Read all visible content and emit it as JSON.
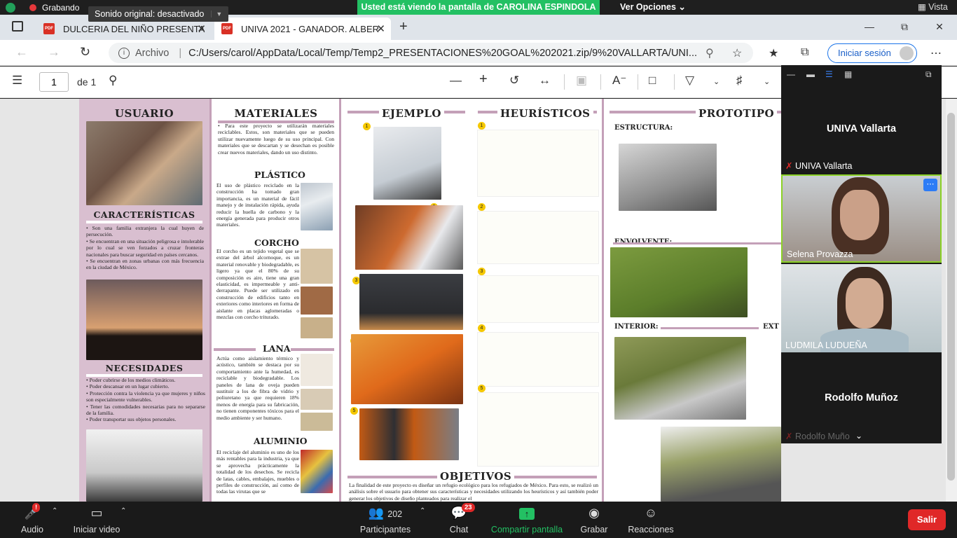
{
  "sharebar": {
    "recording": "Grabando",
    "original_sound": "Sonido original: desactivado",
    "viewing": "Usted está viendo la pantalla de CAROLINA ESPINDOLA",
    "options": "Ver Opciones",
    "view": "Vista",
    "colors": {
      "accent": "#23c063",
      "record": "#e5383b"
    }
  },
  "browser": {
    "tabs": [
      {
        "title": "DULCERIA DEL NIÑO PRESENTA",
        "icon": "pdf-icon"
      },
      {
        "title": "UNIVA 2021 - GANADOR. ALBER",
        "icon": "pdf-icon"
      }
    ],
    "address_prefix": "Archivo",
    "address": "C:/Users/carol/AppData/Local/Temp/Temp2_PRESENTACIONES%20GOAL%202021.zip/9%20VALLARTA/UNI...",
    "signin": "Iniciar sesión"
  },
  "pdf_toolbar": {
    "page": "1",
    "of": "de 1"
  },
  "poster": {
    "usuario": {
      "title": "USUARIO",
      "caracteristicas_title": "CARACTERÍSTICAS",
      "caracteristicas": [
        "Son una familia extranjera la cual huyen de persecución.",
        "Se encuentran en una situación peligrosa e intolerable por lo cual se ven forzados a cruzar fronteras nacionales para buscar seguridad en países cercanos.",
        "Se encuentran en zonas urbanas con más frecuencia en la ciudad de México."
      ],
      "necesidades_title": "NECESIDADES",
      "necesidades": [
        "Poder cubrirse de los medios climáticos.",
        "Poder descansar en un lugar cubierto.",
        "Protección contra la violencia ya que mujeres y niños son especialmente vulnerables.",
        "Tener las comodidades necesarias para no separarse de la familia.",
        "Poder transportar sus objetos personales."
      ]
    },
    "materiales": {
      "title": "MATERIALES",
      "intro": "Para este proyecto se utilizarán materiales reciclables. Estos, son materiales que se pueden utilizar nuevamente luego de su uso principal. Con materiales que se descartan y se desechan es posible crear nuevos materiales, dando un uso distinto.",
      "plastico_title": "PLÁSTICO",
      "plastico": "El uso de plástico reciclado en la construcción ha tomado gran importancia, es un material de fácil manejo y de instalación rápida, ayuda reducir la huella de carbono y la energía generada para producir otros materiales.",
      "corcho_title": "CORCHO",
      "corcho": "El corcho es un tejido vegetal que se extrae del árbol alcornoque, es un material renovable y biodegradable, es ligero ya que el 80% de su composición es aire, tiene una gran elasticidad, es impermeable y anti-derrapante. Puede ser utilizado en construcción de edificios tanto en exteriores como interiores en forma de aislante en placas aglomeradas o mezclas con corcho triturado.",
      "lana_title": "LANA",
      "lana": "Actúa como aislamiento térmico y acústico, también se destaca por su comportamiento ante la humedad, es reciclable y biodegradable. Los paneles de lana de oveja pueden sustituir a los de fibra de vidrio y poliuretano ya que requieren 18% menos de energía para su fabricación, no tienen componentes tóxicos para el medio ambiente y ser humano.",
      "aluminio_title": "ALUMINIO",
      "aluminio": "El reciclaje del aluminio es uno de los más rentables para la industria, ya que se aprovecha prácticamente la totalidad de los desechos. Se recicla de latas, cables, embalajes, muebles o perfiles de construcción, así como de todas las virutas que se"
    },
    "ejemplo": {
      "title": "EJEMPLO",
      "numbers": [
        "1",
        "2",
        "3",
        "4",
        "5"
      ]
    },
    "heuristicos": {
      "title": "HEURÍSTICOS"
    },
    "objetivos": {
      "title": "OBJETIVOS",
      "text": "La finalidad de este proyecto es diseñar un refugio ecológico para los refugiados de México. Para esto, se realizó un análisis sobre el usuario para obtener sus características y necesidades utilizando los heurísticos y así también poder generar los objetivos de diseño planteados para realizar el"
    },
    "prototipo": {
      "title": "PROTOTIPO",
      "estructura": "ESTRUCTURA:",
      "envolvente": "ENVOLVENTE:",
      "interior": "INTERIOR:",
      "exterior": "EXT"
    }
  },
  "video_panel": {
    "participants": [
      {
        "name": "UNIVA Vallarta",
        "type": "name-only"
      },
      {
        "name": "UNIVA Vallarta",
        "type": "label-muted"
      },
      {
        "name": "Selena Provazza",
        "type": "video",
        "active": true
      },
      {
        "name": "LUDMILA LUDUEÑA",
        "type": "video"
      },
      {
        "name": "Rodolfo Muñoz",
        "type": "name-only"
      },
      {
        "name": "Rodolfo Muño",
        "type": "label-muted"
      }
    ]
  },
  "zoom_toolbar": {
    "audio": "Audio",
    "video": "Iniciar video",
    "participants": "Participantes",
    "participants_count": "202",
    "chat": "Chat",
    "chat_badge": "23",
    "share": "Compartir pantalla",
    "record": "Grabar",
    "reactions": "Reacciones",
    "leave": "Salir",
    "audio_badge": "!"
  }
}
